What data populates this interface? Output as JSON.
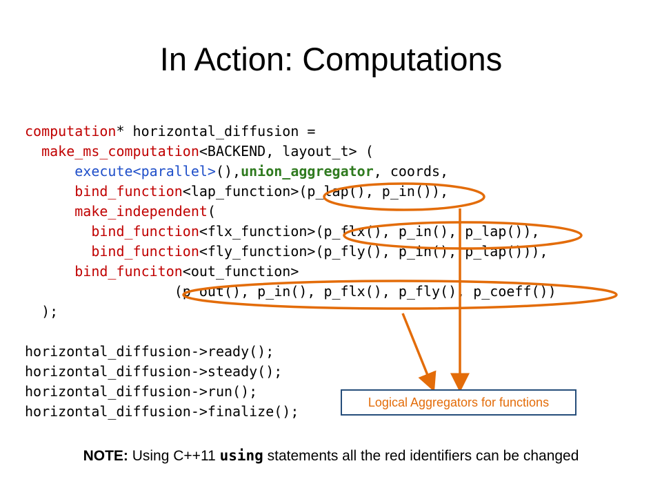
{
  "slide": {
    "title": "In Action: Computations",
    "code": {
      "l1_a": "computation",
      "l1_b": "* horizontal_diffusion =",
      "l2_indent": "  ",
      "l2_a": "make_ms_computation",
      "l2_b": "<BACKEND, layout_t> (",
      "l3_indent": "      ",
      "l3_a": "execute<parallel>",
      "l3_b": "(),",
      "l3_c": "union_aggregator",
      "l3_d": ", coords,",
      "l4_indent": "      ",
      "l4_a": "bind_function",
      "l4_b": "<lap_function>(p_lap(), p_in()),",
      "l5_indent": "      ",
      "l5_a": "make_independent",
      "l5_b": "(",
      "l6_indent": "        ",
      "l6_a": "bind_function",
      "l6_b": "<flx_function>(p_flx(), p_in(), p_lap()),",
      "l7_indent": "        ",
      "l7_a": "bind_function",
      "l7_b": "<fly_function>(p_fly(), p_in(), p_lap())),",
      "l8_indent": "      ",
      "l8_a": "bind_funciton",
      "l8_b": "<out_function>",
      "l9": "                  (p_out(), p_in(), p_flx(), p_fly(), p_coeff())",
      "l10": "  );",
      "l11": "horizontal_diffusion->ready();",
      "l12": "horizontal_diffusion->steady();",
      "l13": "horizontal_diffusion->run();",
      "l14": "horizontal_diffusion->finalize();"
    },
    "callout": "Logical Aggregators for functions",
    "note": {
      "label": "NOTE:",
      "pre": " Using C++11 ",
      "keyword": "using",
      "post": " statements all the red identifiers can be changed"
    },
    "colors": {
      "red": "#c00000",
      "blue": "#1f4fc9",
      "green": "#2f7a1f",
      "orange": "#e36c09",
      "box_border": "#254d7a"
    }
  }
}
